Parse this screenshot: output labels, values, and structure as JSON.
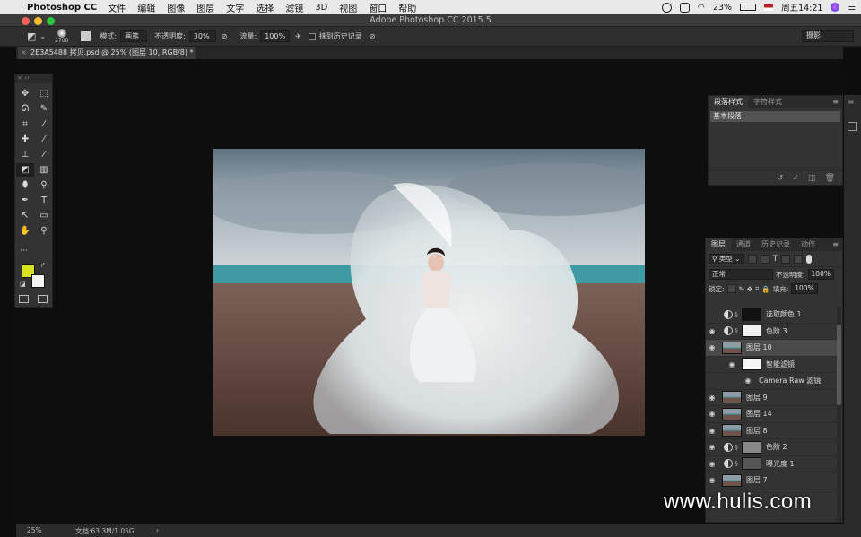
{
  "menubar": {
    "app_name": "Photoshop CC",
    "items": [
      "文件",
      "编辑",
      "图像",
      "图层",
      "文字",
      "选择",
      "滤镜",
      "3D",
      "视图",
      "窗口",
      "帮助"
    ],
    "battery": "23%",
    "clock": "周五14:21"
  },
  "window": {
    "title": "Adobe Photoshop CC 2015.5"
  },
  "options": {
    "brush_size": "2700",
    "mode_label": "模式:",
    "mode_value": "画笔",
    "opacity_label": "不透明度:",
    "opacity_value": "30%",
    "flow_label": "流量:",
    "flow_value": "100%",
    "history_label": "抹到历史记录",
    "workspace": "摄影"
  },
  "document": {
    "tab_title": "2E3A5488 拷贝.psd @ 25% (图层 10, RGB/8) *"
  },
  "tools": {
    "icons": [
      "move-icon",
      "marquee-icon",
      "lasso-icon",
      "quick-select-icon",
      "crop-icon",
      "eyedropper-icon",
      "healing-icon",
      "brush-icon",
      "stamp-icon",
      "history-brush-icon",
      "eraser-icon",
      "gradient-icon",
      "blur-icon",
      "dodge-icon",
      "pen-icon",
      "type-icon",
      "path-select-icon",
      "shape-icon",
      "hand-icon",
      "zoom-icon"
    ],
    "glyphs": [
      "✥",
      "⬚",
      "ᘏ",
      "✎",
      "⌗",
      "⁄",
      "✚",
      "⁄",
      "⊥",
      "⁄",
      "◩",
      "▥",
      "⬮",
      "⚲",
      "✒",
      "T",
      "↖",
      "▭",
      "✋",
      "⚲"
    ],
    "more": "···",
    "fg_color": "#d8e21d",
    "bg_color": "#f4f4f4"
  },
  "paragraph_panel": {
    "tabs": [
      "段落样式",
      "字符样式"
    ],
    "item": "基本段落"
  },
  "layers_panel": {
    "tabs": [
      "图层",
      "通道",
      "历史记录",
      "动作"
    ],
    "filter_kind": "类型",
    "blend_mode": "正常",
    "opacity_label": "不透明度:",
    "opacity_value": "100%",
    "lock_label": "锁定:",
    "fill_label": "填充:",
    "fill_value": "100%",
    "layers": [
      {
        "name": "选取颜色 1",
        "type": "adjustment",
        "visible": false,
        "mask": "#111111"
      },
      {
        "name": "色阶 3",
        "type": "adjustment",
        "visible": true,
        "mask": "#f2f2f2"
      },
      {
        "name": "图层 10",
        "type": "smart",
        "visible": true,
        "active": true
      },
      {
        "name": "智能滤镜",
        "type": "smartfilter",
        "visible": true
      },
      {
        "name": "Camera Raw 滤镜",
        "type": "filter",
        "visible": true
      },
      {
        "name": "图层 9",
        "type": "pixel",
        "visible": true
      },
      {
        "name": "图层 14",
        "type": "pixel",
        "visible": true
      },
      {
        "name": "图层 8",
        "type": "pixel",
        "visible": true
      },
      {
        "name": "色阶 2",
        "type": "adjustment",
        "visible": true,
        "mask": "#888888"
      },
      {
        "name": "曝光度 1",
        "type": "adjustment",
        "visible": true,
        "mask": "#555555"
      },
      {
        "name": "图层 7",
        "type": "pixel",
        "visible": true
      }
    ]
  },
  "status": {
    "zoom": "25%",
    "doc_size": "文档:63.3M/1.05G"
  },
  "watermark": "www.hulis.com"
}
